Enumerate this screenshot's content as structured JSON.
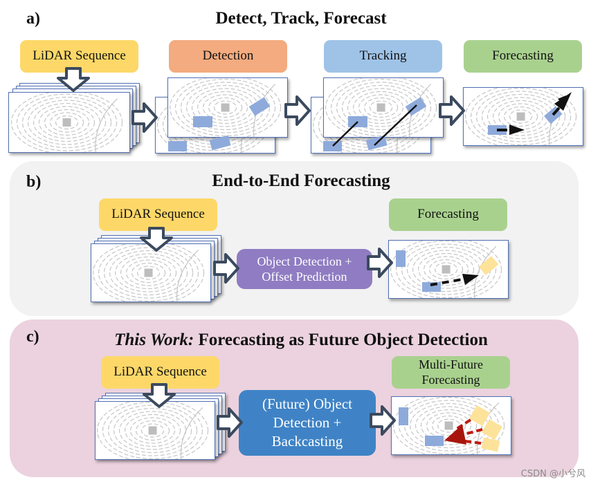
{
  "panel_a": {
    "label": "a)",
    "title": "Detect, Track, Forecast",
    "stages": [
      "LiDAR Sequence",
      "Detection",
      "Tracking",
      "Forecasting"
    ]
  },
  "panel_b": {
    "label": "b)",
    "title": "End-to-End Forecasting",
    "input_label": "LiDAR Sequence",
    "process_line1": "Object Detection +",
    "process_line2": "Offset Prediction",
    "output_label": "Forecasting"
  },
  "panel_c": {
    "label": "c)",
    "title_italic": "This Work:",
    "title_rest": " Forecasting as Future Object Detection",
    "input_label": "LiDAR Sequence",
    "process_line1": "(Future) Object",
    "process_line2": "Detection +",
    "process_line3": "Backcasting",
    "output_line1": "Multi-Future",
    "output_line2": "Forecasting"
  },
  "watermark": "CSDN @小兮风",
  "colors": {
    "lidar_yellow": "#fdd868",
    "detection_orange": "#f3ab7f",
    "tracking_blue": "#9fc3e7",
    "forecast_green": "#a9d18e",
    "process_purple": "#8f7cc2",
    "process_blue": "#3f83c6",
    "object_box": "#8eaadb",
    "future_box": "#fde29a",
    "backcast_red": "#c0190f",
    "arrow_outline": "#3b4a5e"
  }
}
